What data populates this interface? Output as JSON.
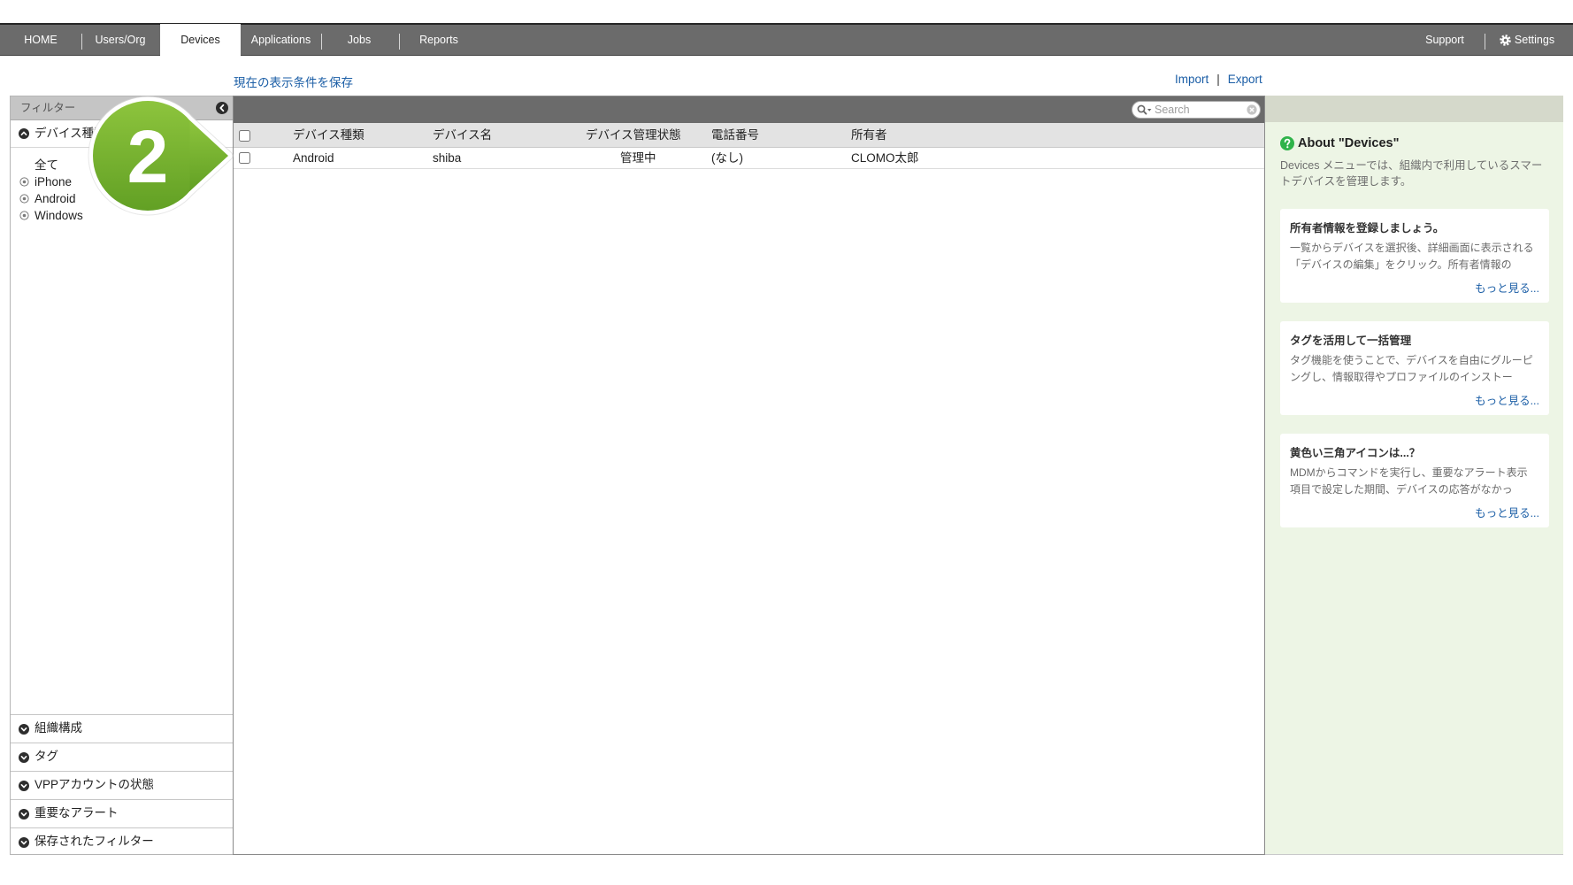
{
  "nav": {
    "items": [
      {
        "label": "HOME"
      },
      {
        "label": "Users/Org"
      },
      {
        "label": "Devices",
        "active": true
      },
      {
        "label": "Applications"
      },
      {
        "label": "Jobs"
      },
      {
        "label": "Reports"
      }
    ],
    "support": "Support",
    "settings": "Settings"
  },
  "actions": {
    "save_view": "現在の表示条件を保存",
    "import": "Import",
    "divider": "|",
    "export": "Export"
  },
  "filter": {
    "title": "フィルター",
    "device_type": {
      "label": "デバイス種類",
      "options": [
        "全て",
        "iPhone",
        "Android",
        "Windows"
      ]
    },
    "sections": [
      "組織構成",
      "タグ",
      "VPPアカウントの状態",
      "重要なアラート",
      "保存されたフィルター"
    ]
  },
  "search": {
    "placeholder": "Search"
  },
  "table": {
    "columns": [
      "デバイス種類",
      "デバイス名",
      "デバイス管理状態",
      "電話番号",
      "所有者"
    ],
    "rows": [
      [
        "Android",
        "shiba",
        "管理中",
        "(なし)",
        "CLOMO太郎"
      ]
    ]
  },
  "help": {
    "title": "About \"Devices\"",
    "description": "Devices メニューでは、組織内で利用しているスマートデバイスを管理します。",
    "cards": [
      {
        "title": "所有者情報を登録しましょう。",
        "body": "一覧からデバイスを選択後、詳細画面に表示される「デバイスの編集」をクリック。所有者情報の",
        "more": "もっと見る..."
      },
      {
        "title": "タグを活用して一括管理",
        "body": "タグ機能を使うことで、デバイスを自由にグルーピングし、情報取得やプロファイルのインストー",
        "more": "もっと見る..."
      },
      {
        "title": "黄色い三角アイコンは...？",
        "body": "MDMからコマンドを実行し、重要なアラート表示項目で設定した期間、デバイスの応答がなかっ",
        "more": "もっと見る..."
      }
    ]
  },
  "callout": {
    "number": "2"
  },
  "icons": {
    "settings": "gear-icon",
    "collapse_sidebar": "chevron-left-circle-icon",
    "section_expanded": "chevron-up-circle-icon",
    "section_collapsed": "chevron-down-circle-icon",
    "filter_option": "radio-icon",
    "search": "search-icon",
    "clear_search": "clear-icon",
    "help": "question-icon"
  },
  "colors": {
    "nav_bar": "#6b6b6b",
    "link": "#1b5ea6",
    "help_panel": "#edf5e5",
    "help_icon": "#2fb34a",
    "callout": "#7ab32e"
  }
}
